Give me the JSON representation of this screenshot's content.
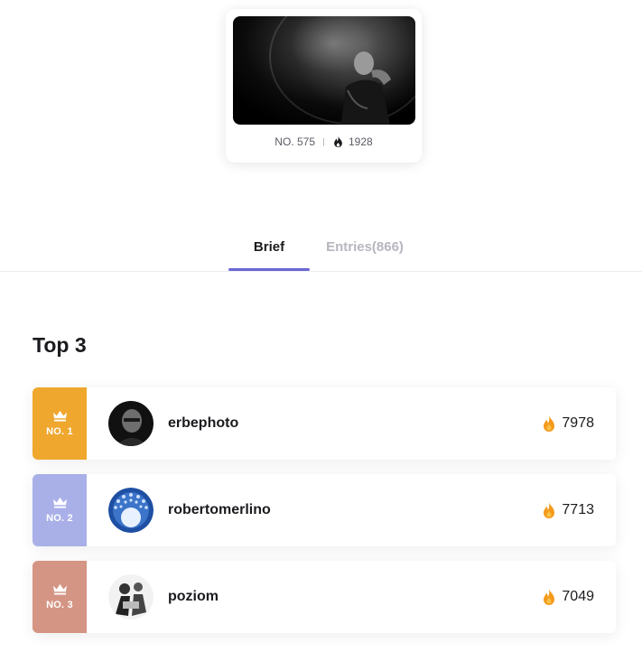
{
  "feature": {
    "number": "NO. 575",
    "heat": "1928"
  },
  "tabs": [
    {
      "label": "Brief",
      "active": true
    },
    {
      "label": "Entries(866)",
      "active": false
    }
  ],
  "top3": {
    "title": "Top 3",
    "entries": [
      {
        "rank": "NO. 1",
        "username": "erbephoto",
        "score": "7978",
        "badge_color": "#efa72e"
      },
      {
        "rank": "NO. 2",
        "username": "robertomerlino",
        "score": "7713",
        "badge_color": "#a9b0e8"
      },
      {
        "rank": "NO. 3",
        "username": "poziom",
        "score": "7049",
        "badge_color": "#d59584"
      }
    ]
  },
  "colors": {
    "accent": "#6b67d6",
    "tab_inactive": "#b6b6bf",
    "fire": "#f59a1b"
  }
}
